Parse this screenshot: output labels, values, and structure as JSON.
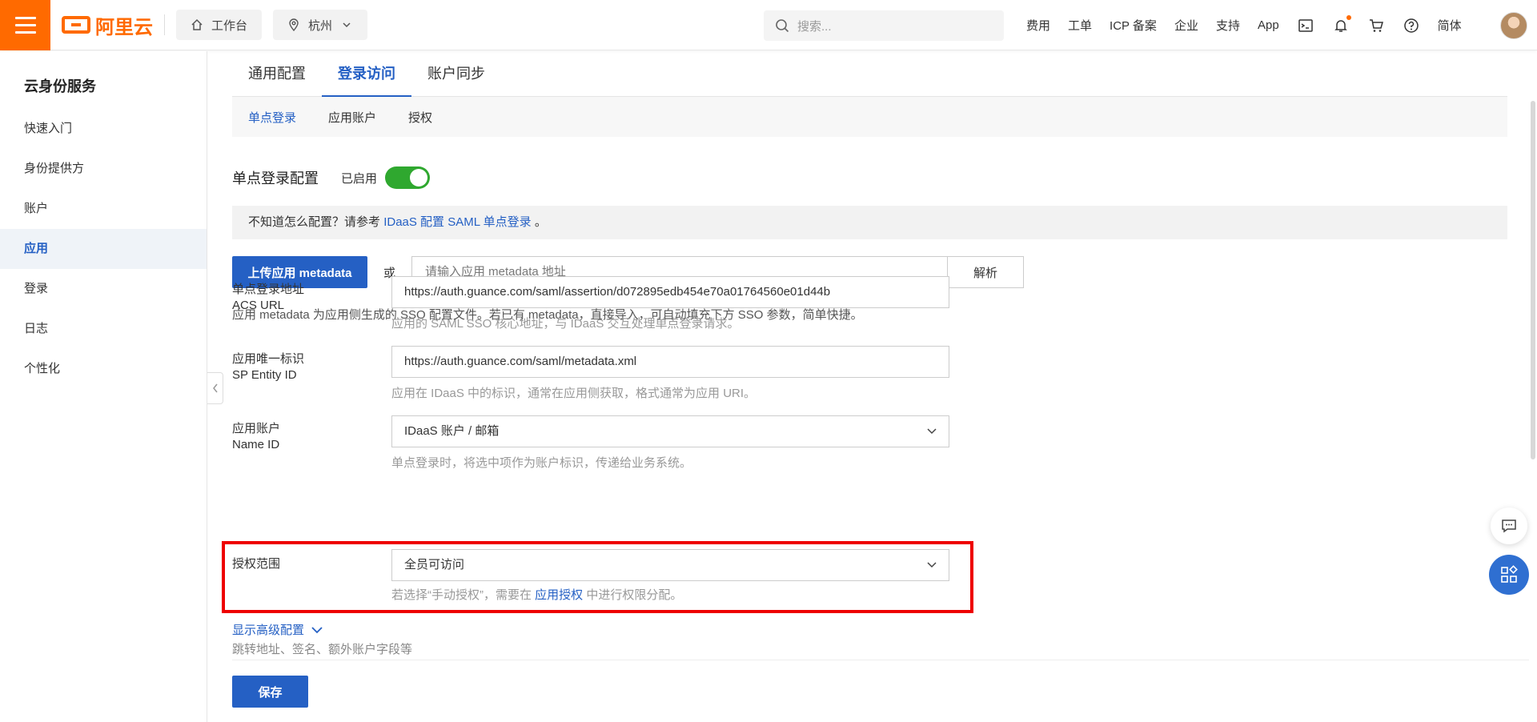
{
  "header": {
    "brand": "阿里云",
    "workbench": "工作台",
    "region": "杭州",
    "search_placeholder": "搜索...",
    "links": [
      "费用",
      "工单",
      "ICP 备案",
      "企业",
      "支持",
      "App"
    ],
    "language": "简体",
    "brand_color": "#ff6a00"
  },
  "sidebar": {
    "title": "云身份服务",
    "items": [
      {
        "label": "快速入门"
      },
      {
        "label": "身份提供方"
      },
      {
        "label": "账户"
      },
      {
        "label": "应用"
      },
      {
        "label": "登录"
      },
      {
        "label": "日志"
      },
      {
        "label": "个性化"
      }
    ],
    "active_index": 3
  },
  "tabs": [
    "通用配置",
    "登录访问",
    "账户同步"
  ],
  "active_tab": 1,
  "subtabs": [
    "单点登录",
    "应用账户",
    "授权"
  ],
  "active_subtab": 0,
  "sso": {
    "title": "单点登录配置",
    "status": "已启用",
    "enabled": true
  },
  "notice": {
    "prefix": "不知道怎么配置？请参考",
    "link": "IDaaS 配置 SAML 单点登录",
    "suffix": "。"
  },
  "metadata": {
    "upload_label": "上传应用 metadata",
    "or": "或",
    "input_placeholder": "请输入应用 metadata 地址",
    "parse_label": "解析",
    "help": "应用 metadata 为应用侧生成的 SSO 配置文件。若已有 metadata，直接导入，可自动填充下方 SSO 参数，简单快捷。"
  },
  "form": {
    "acs": {
      "label": "单点登录地址",
      "sublabel": "ACS URL",
      "value": "https://auth.guance.com/saml/assertion/d072895edb454e70a01764560e01d44b",
      "help": "应用的 SAML SSO 核心地址，与 IDaaS 交互处理单点登录请求。"
    },
    "entity": {
      "label": "应用唯一标识",
      "sublabel": "SP Entity ID",
      "value": "https://auth.guance.com/saml/metadata.xml",
      "help": "应用在 IDaaS 中的标识，通常在应用侧获取，格式通常为应用 URI。"
    },
    "nameid": {
      "label": "应用账户",
      "sublabel": "Name ID",
      "value": "IDaaS 账户 / 邮箱",
      "help": "单点登录时，将选中项作为账户标识，传递给业务系统。"
    },
    "scope": {
      "label": "授权范围",
      "value": "全员可访问",
      "help_prefix": "若选择“手动授权”，需要在",
      "help_link": "应用授权",
      "help_suffix": "中进行权限分配。"
    }
  },
  "advanced": {
    "label": "显示高级配置",
    "help": "跳转地址、签名、额外账户字段等"
  },
  "save_label": "保存"
}
